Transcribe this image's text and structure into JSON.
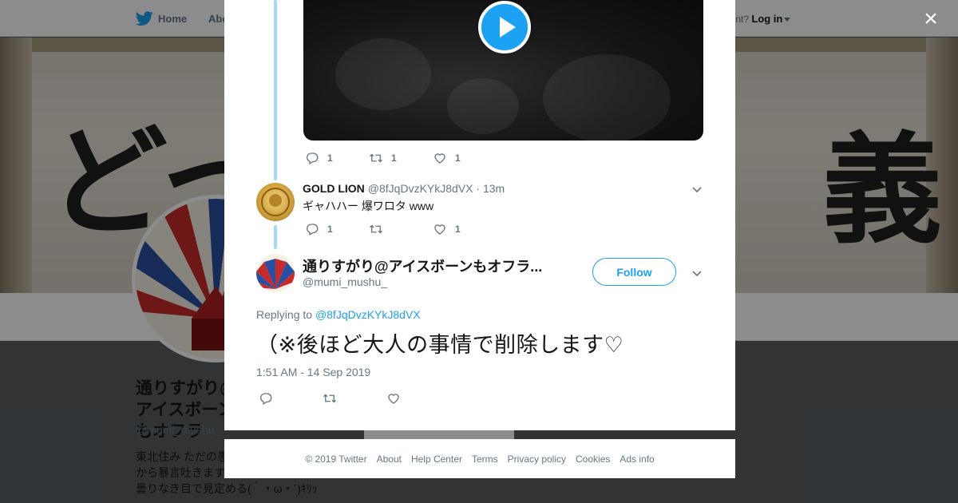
{
  "nav": {
    "home_label": "Home",
    "about_label": "Abo",
    "account_prompt": "ccount?",
    "login_label": "Log in"
  },
  "banner": {
    "glyph_left": "どっ",
    "glyph_right": "義"
  },
  "profile": {
    "name": "通りすがり@アイスボーンもオフラ",
    "handle": "@mumi_mushu_",
    "bio_lines": [
      "東北住み ただの愚",
      "から暴言吐きます",
      "曇りなき目で見定める(｀・ω・´)ｷﾘｯ"
    ],
    "ads_ghost": "Ads info"
  },
  "modal": {
    "video_tweet": {
      "reply_count": "1",
      "retweet_count": "1",
      "like_count": "1"
    },
    "reply_tweet": {
      "name": "GOLD LION",
      "handle": "@8fJqDvzKYkJ8dVX",
      "time": "· 13m",
      "text": "ギャハハー 爆ワロタ www",
      "reply_count": "1",
      "retweet_count": "",
      "like_count": "1"
    },
    "main_tweet": {
      "name": "通りすがり@アイスボーンもオフラ...",
      "handle": "@mumi_mushu_",
      "follow_label": "Follow",
      "replying_prefix": "Replying to ",
      "replying_handle": "@8fJqDvzKYkJ8dVX",
      "text": "（※後ほど大人の事情で削除します♡",
      "timestamp": "1:51 AM - 14 Sep 2019"
    }
  },
  "close_label": "×",
  "footer": {
    "copyright": "© 2019 Twitter",
    "links": [
      "About",
      "Help Center",
      "Terms",
      "Privacy policy",
      "Cookies",
      "Ads info"
    ]
  },
  "colors": {
    "accent": "#1da1f2",
    "thread_line": "#a6d8f7",
    "text_primary": "#14171a",
    "text_secondary": "#657786"
  },
  "icons": [
    "twitter-bird-icon",
    "reply-icon",
    "retweet-icon",
    "like-icon",
    "chevron-down-icon",
    "play-icon",
    "close-icon"
  ]
}
